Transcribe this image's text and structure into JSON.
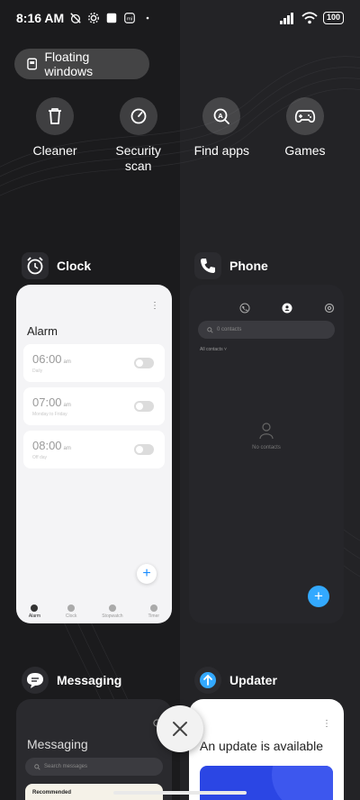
{
  "status_bar": {
    "time": "8:16 AM",
    "battery": "100",
    "icons": [
      "alarm-off-icon",
      "settings-icon",
      "square-icon",
      "mi-icon",
      "dot-icon",
      "signal-icon",
      "wifi-icon",
      "battery-icon"
    ]
  },
  "floating_windows": {
    "label": "Floating windows",
    "icon": "window-icon"
  },
  "quick_tools": [
    {
      "label": "Cleaner",
      "icon": "trash-icon"
    },
    {
      "label": "Security\nscan",
      "icon": "gauge-icon"
    },
    {
      "label": "Find apps",
      "icon": "app-search-icon"
    },
    {
      "label": "Games",
      "icon": "gamepad-icon"
    }
  ],
  "apps": {
    "clock": {
      "name": "Clock",
      "title": "Alarm",
      "alarms": [
        {
          "time": "06:00",
          "ampm": "am",
          "sub": "Daily",
          "enabled": false
        },
        {
          "time": "07:00",
          "ampm": "am",
          "sub": "Monday to Friday",
          "enabled": false
        },
        {
          "time": "08:00",
          "ampm": "am",
          "sub": "Off day",
          "enabled": false
        }
      ],
      "tabs": [
        "Alarm",
        "Clock",
        "Stopwatch",
        "Timer"
      ],
      "active_tab": 0
    },
    "phone": {
      "name": "Phone",
      "search_placeholder": "0 contacts",
      "contacts_label": "All contacts ˅",
      "empty_text": "No contacts"
    },
    "messaging": {
      "name": "Messaging",
      "title": "Messaging",
      "search_placeholder": "Search messages",
      "recommended": "Recommended"
    },
    "updater": {
      "name": "Updater",
      "title": "An update is available"
    }
  },
  "colors": {
    "accent_blue": "#33a9ff",
    "background": "#1b1b1d",
    "updater_banner": "#2b46e4"
  }
}
